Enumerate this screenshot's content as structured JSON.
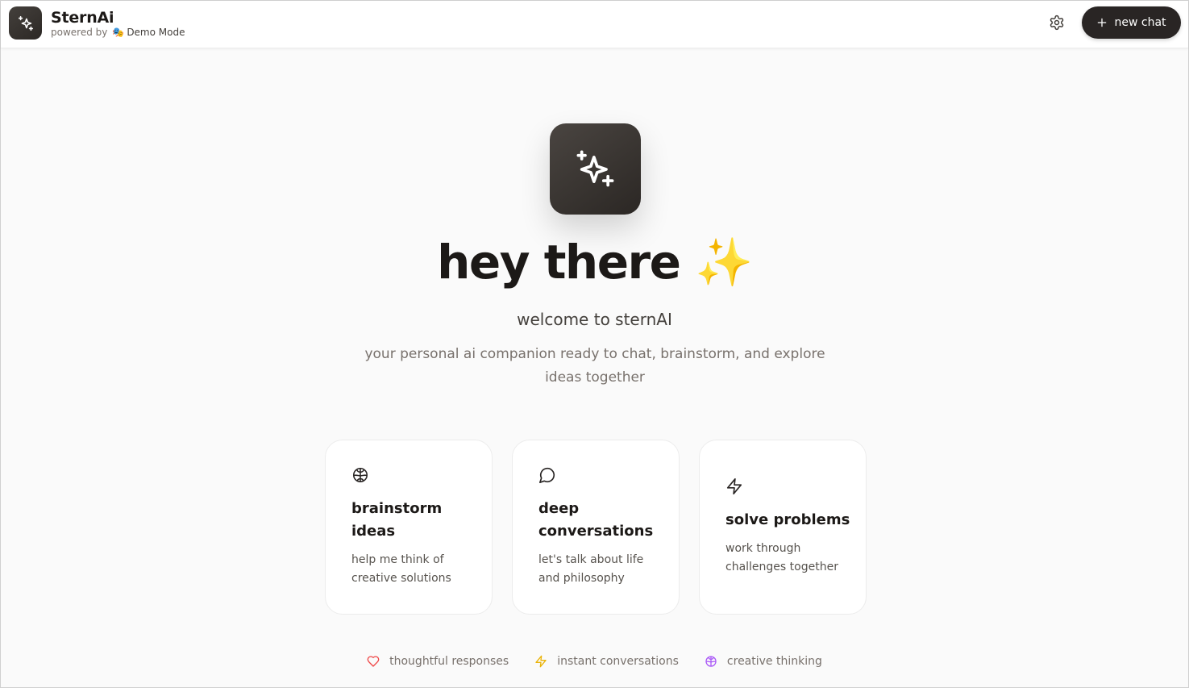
{
  "header": {
    "brand_name": "SternAi",
    "powered_by": "powered by",
    "mode_label": "Demo Mode",
    "new_chat_label": "new chat"
  },
  "hero": {
    "title": "hey there ✨",
    "subtitle": "welcome to sternAI",
    "description": "your personal ai companion ready to chat, brainstorm, and explore ideas together"
  },
  "cards": [
    {
      "icon": "brain-icon",
      "title": "brainstorm ideas",
      "text": "help me think of creative solutions"
    },
    {
      "icon": "message-circle-icon",
      "title": "deep conversations",
      "text": "let's talk about life and philosophy"
    },
    {
      "icon": "lightning-icon",
      "title": "solve problems",
      "text": "work through challenges together"
    }
  ],
  "features": [
    {
      "icon": "heart-icon",
      "label": "thoughtful responses",
      "color": "#ef4444"
    },
    {
      "icon": "lightning-icon",
      "label": "instant conversations",
      "color": "#eab308"
    },
    {
      "icon": "brain-icon",
      "label": "creative thinking",
      "color": "#a855f7"
    }
  ],
  "colors": {
    "accent_dark": "#292524",
    "background": "#fafafa"
  }
}
